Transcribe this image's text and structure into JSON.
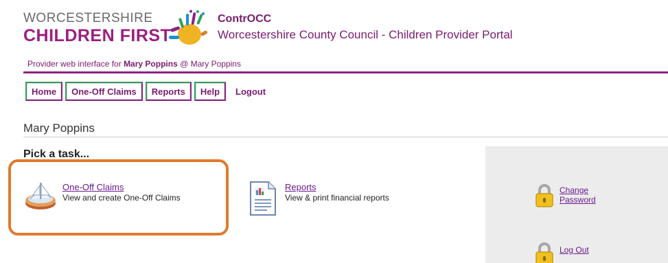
{
  "logo": {
    "line1": "WORCESTERSHIRE",
    "line2": "CHILDREN FIRST",
    "icon": "handprint-logo-icon"
  },
  "app": {
    "title": "ContrOCC",
    "subtitle": "Worcestershire County Council - Children Provider Portal"
  },
  "provider": {
    "prefix": "Provider web interface for ",
    "name": "Mary Poppins",
    "separator": " @ ",
    "org": "Mary Poppins"
  },
  "nav": {
    "home": "Home",
    "one_off_claims": "One-Off Claims",
    "reports": "Reports",
    "help": "Help",
    "logout": "Logout"
  },
  "page": {
    "user_name": "Mary Poppins",
    "pick_task": "Pick a task..."
  },
  "tasks": [
    {
      "label": "One-Off Claims",
      "description": "View and create One-Off Claims",
      "icon": "boat-icon"
    },
    {
      "label": "Reports",
      "description": "View & print financial reports",
      "icon": "report-document-icon"
    }
  ],
  "side": {
    "change_password_line1": "Change",
    "change_password_line2": "Password",
    "log_out": "Log Out",
    "icon": "padlock-icon"
  },
  "colors": {
    "brand_purple": "#8b2383",
    "brand_green": "#2fa05a",
    "highlight_orange": "#e07a2e"
  }
}
